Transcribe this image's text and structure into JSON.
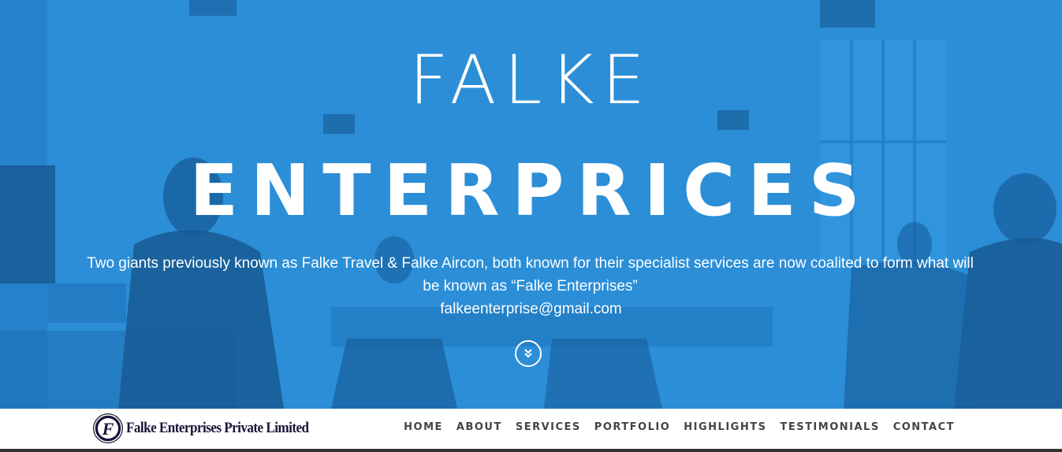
{
  "hero": {
    "title_line1": "FALKE",
    "title_line2": "ENTERPRICES",
    "description": "Two giants previously known as Falke Travel & Falke Aircon, both known for their specialist services are now coalited to form what will be known as “Falke Enterprises”",
    "email": "falkeenterprise@gmail.com",
    "scroll_icon": "double-chevron-down-icon",
    "overlay_color": "#2b8ed8"
  },
  "navbar": {
    "logo_icon": "falke-f-monogram-icon",
    "logo_text": "Falke Enterprises Private Limited",
    "logo_letter": "F",
    "menu": [
      {
        "label": "HOME"
      },
      {
        "label": "ABOUT"
      },
      {
        "label": "SERVICES"
      },
      {
        "label": "PORTFOLIO"
      },
      {
        "label": "HIGHLIGHTS"
      },
      {
        "label": "TESTIMONIALS"
      },
      {
        "label": "CONTACT"
      }
    ]
  },
  "colors": {
    "hero_blue": "#2b8ed8",
    "logo_navy": "#1a1438",
    "nav_text": "#444444",
    "nav_border": "#333333"
  }
}
